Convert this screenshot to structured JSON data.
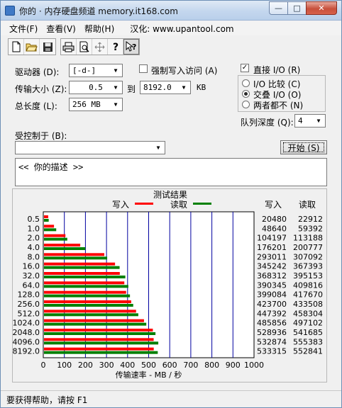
{
  "window": {
    "title": "你的 · 内存硬盘频道 memory.it168.com",
    "caption": {
      "minimize": "—",
      "maximize": "□",
      "close": "✕"
    },
    "accent": "#b9cfea"
  },
  "menu": {
    "file": "文件(F)",
    "view": "查看(V)",
    "help": "帮助(H)",
    "localize": "汉化: www.upantool.com"
  },
  "toolbar": {
    "icons": [
      "new-doc-icon",
      "open-folder-icon",
      "save-disk-icon",
      "print-icon",
      "print-preview-icon",
      "move-cross-icon",
      "help-icon",
      "context-help-icon"
    ]
  },
  "settings": {
    "drive_label": "驱动器 (D):",
    "drive_value": "[-d-]",
    "transfer_label": "传输大小 (Z):",
    "transfer_from": "0.5",
    "transfer_to_label": "到",
    "transfer_to": "8192.0",
    "transfer_unit": "KB",
    "total_label": "总长度 (L):",
    "total_value": "256 MB",
    "force_write_label": "强制写入访问 (A)",
    "force_write_checked": false,
    "direct_io_label": "直接 I/O (R)",
    "direct_io_checked": true,
    "io_compare_label": "I/O 比较 (C)",
    "overlap_io_label": "交叠 I/O (O)",
    "neither_label": "两者都不 (N)",
    "selected_mode": "overlap",
    "queue_label": "队列深度 (Q):",
    "queue_value": "4",
    "controlled_by_label": "受控制于 (B):",
    "controlled_by_value": "",
    "start_button": "开始 (S)",
    "description": "<<  你的描述   >>"
  },
  "chart_data": {
    "type": "bar",
    "title": "测试结果",
    "legend": [
      {
        "name": "写入",
        "color": "#ff0000"
      },
      {
        "name": "读取",
        "color": "#008000"
      }
    ],
    "legend_placement": "top-center",
    "categories": [
      "0.5",
      "1.0",
      "2.0",
      "4.0",
      "8.0",
      "16.0",
      "32.0",
      "64.0",
      "128.0",
      "256.0",
      "512.0",
      "1024.0",
      "2048.0",
      "4096.0",
      "8192.0"
    ],
    "series": [
      {
        "name": "写入",
        "values": [
          20480,
          48640,
          104197,
          176201,
          293011,
          345242,
          368312,
          390345,
          399084,
          423700,
          447392,
          485856,
          528936,
          532874,
          533315
        ]
      },
      {
        "name": "读取",
        "values": [
          22912,
          59392,
          113188,
          200777,
          307092,
          367393,
          395153,
          409816,
          417670,
          433508,
          458304,
          497102,
          541685,
          555383,
          552841
        ]
      }
    ],
    "column_headers": [
      "写入",
      "读取"
    ],
    "xlabel": "传输速率 - MB / 秒",
    "xticks": [
      0,
      100,
      200,
      300,
      400,
      500,
      600,
      700,
      800,
      900,
      1000
    ],
    "xlim": [
      0,
      1000
    ],
    "grid": true,
    "background": "#ffffff",
    "gridline_color": "#0000a0"
  },
  "status": {
    "text": "要获得帮助，请按 F1"
  }
}
